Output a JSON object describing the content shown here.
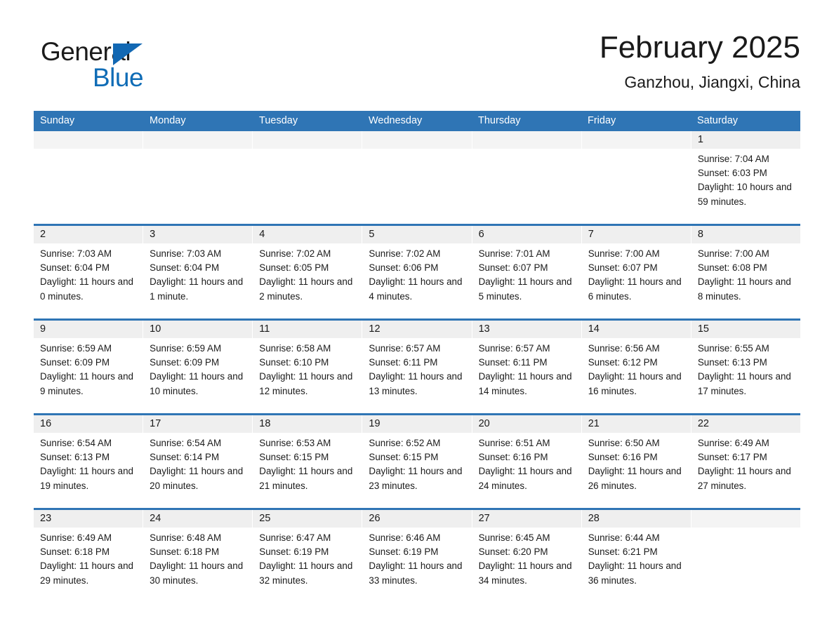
{
  "brand": {
    "name_part1": "General",
    "name_part2": "Blue",
    "accent_color": "#0f6cb6",
    "triangle_color": "#1268b3"
  },
  "header": {
    "title": "February 2025",
    "location": "Ganzhou, Jiangxi, China"
  },
  "theme": {
    "header_blue": "#2f75b5",
    "day_band_gray": "#efefef",
    "text_color": "#1a1a1a"
  },
  "weekdays": [
    "Sunday",
    "Monday",
    "Tuesday",
    "Wednesday",
    "Thursday",
    "Friday",
    "Saturday"
  ],
  "weeks": [
    [
      {
        "day": "",
        "sunrise": "",
        "sunset": "",
        "daylight": ""
      },
      {
        "day": "",
        "sunrise": "",
        "sunset": "",
        "daylight": ""
      },
      {
        "day": "",
        "sunrise": "",
        "sunset": "",
        "daylight": ""
      },
      {
        "day": "",
        "sunrise": "",
        "sunset": "",
        "daylight": ""
      },
      {
        "day": "",
        "sunrise": "",
        "sunset": "",
        "daylight": ""
      },
      {
        "day": "",
        "sunrise": "",
        "sunset": "",
        "daylight": ""
      },
      {
        "day": "1",
        "sunrise": "Sunrise: 7:04 AM",
        "sunset": "Sunset: 6:03 PM",
        "daylight": "Daylight: 10 hours and 59 minutes."
      }
    ],
    [
      {
        "day": "2",
        "sunrise": "Sunrise: 7:03 AM",
        "sunset": "Sunset: 6:04 PM",
        "daylight": "Daylight: 11 hours and 0 minutes."
      },
      {
        "day": "3",
        "sunrise": "Sunrise: 7:03 AM",
        "sunset": "Sunset: 6:04 PM",
        "daylight": "Daylight: 11 hours and 1 minute."
      },
      {
        "day": "4",
        "sunrise": "Sunrise: 7:02 AM",
        "sunset": "Sunset: 6:05 PM",
        "daylight": "Daylight: 11 hours and 2 minutes."
      },
      {
        "day": "5",
        "sunrise": "Sunrise: 7:02 AM",
        "sunset": "Sunset: 6:06 PM",
        "daylight": "Daylight: 11 hours and 4 minutes."
      },
      {
        "day": "6",
        "sunrise": "Sunrise: 7:01 AM",
        "sunset": "Sunset: 6:07 PM",
        "daylight": "Daylight: 11 hours and 5 minutes."
      },
      {
        "day": "7",
        "sunrise": "Sunrise: 7:00 AM",
        "sunset": "Sunset: 6:07 PM",
        "daylight": "Daylight: 11 hours and 6 minutes."
      },
      {
        "day": "8",
        "sunrise": "Sunrise: 7:00 AM",
        "sunset": "Sunset: 6:08 PM",
        "daylight": "Daylight: 11 hours and 8 minutes."
      }
    ],
    [
      {
        "day": "9",
        "sunrise": "Sunrise: 6:59 AM",
        "sunset": "Sunset: 6:09 PM",
        "daylight": "Daylight: 11 hours and 9 minutes."
      },
      {
        "day": "10",
        "sunrise": "Sunrise: 6:59 AM",
        "sunset": "Sunset: 6:09 PM",
        "daylight": "Daylight: 11 hours and 10 minutes."
      },
      {
        "day": "11",
        "sunrise": "Sunrise: 6:58 AM",
        "sunset": "Sunset: 6:10 PM",
        "daylight": "Daylight: 11 hours and 12 minutes."
      },
      {
        "day": "12",
        "sunrise": "Sunrise: 6:57 AM",
        "sunset": "Sunset: 6:11 PM",
        "daylight": "Daylight: 11 hours and 13 minutes."
      },
      {
        "day": "13",
        "sunrise": "Sunrise: 6:57 AM",
        "sunset": "Sunset: 6:11 PM",
        "daylight": "Daylight: 11 hours and 14 minutes."
      },
      {
        "day": "14",
        "sunrise": "Sunrise: 6:56 AM",
        "sunset": "Sunset: 6:12 PM",
        "daylight": "Daylight: 11 hours and 16 minutes."
      },
      {
        "day": "15",
        "sunrise": "Sunrise: 6:55 AM",
        "sunset": "Sunset: 6:13 PM",
        "daylight": "Daylight: 11 hours and 17 minutes."
      }
    ],
    [
      {
        "day": "16",
        "sunrise": "Sunrise: 6:54 AM",
        "sunset": "Sunset: 6:13 PM",
        "daylight": "Daylight: 11 hours and 19 minutes."
      },
      {
        "day": "17",
        "sunrise": "Sunrise: 6:54 AM",
        "sunset": "Sunset: 6:14 PM",
        "daylight": "Daylight: 11 hours and 20 minutes."
      },
      {
        "day": "18",
        "sunrise": "Sunrise: 6:53 AM",
        "sunset": "Sunset: 6:15 PM",
        "daylight": "Daylight: 11 hours and 21 minutes."
      },
      {
        "day": "19",
        "sunrise": "Sunrise: 6:52 AM",
        "sunset": "Sunset: 6:15 PM",
        "daylight": "Daylight: 11 hours and 23 minutes."
      },
      {
        "day": "20",
        "sunrise": "Sunrise: 6:51 AM",
        "sunset": "Sunset: 6:16 PM",
        "daylight": "Daylight: 11 hours and 24 minutes."
      },
      {
        "day": "21",
        "sunrise": "Sunrise: 6:50 AM",
        "sunset": "Sunset: 6:16 PM",
        "daylight": "Daylight: 11 hours and 26 minutes."
      },
      {
        "day": "22",
        "sunrise": "Sunrise: 6:49 AM",
        "sunset": "Sunset: 6:17 PM",
        "daylight": "Daylight: 11 hours and 27 minutes."
      }
    ],
    [
      {
        "day": "23",
        "sunrise": "Sunrise: 6:49 AM",
        "sunset": "Sunset: 6:18 PM",
        "daylight": "Daylight: 11 hours and 29 minutes."
      },
      {
        "day": "24",
        "sunrise": "Sunrise: 6:48 AM",
        "sunset": "Sunset: 6:18 PM",
        "daylight": "Daylight: 11 hours and 30 minutes."
      },
      {
        "day": "25",
        "sunrise": "Sunrise: 6:47 AM",
        "sunset": "Sunset: 6:19 PM",
        "daylight": "Daylight: 11 hours and 32 minutes."
      },
      {
        "day": "26",
        "sunrise": "Sunrise: 6:46 AM",
        "sunset": "Sunset: 6:19 PM",
        "daylight": "Daylight: 11 hours and 33 minutes."
      },
      {
        "day": "27",
        "sunrise": "Sunrise: 6:45 AM",
        "sunset": "Sunset: 6:20 PM",
        "daylight": "Daylight: 11 hours and 34 minutes."
      },
      {
        "day": "28",
        "sunrise": "Sunrise: 6:44 AM",
        "sunset": "Sunset: 6:21 PM",
        "daylight": "Daylight: 11 hours and 36 minutes."
      },
      {
        "day": "",
        "sunrise": "",
        "sunset": "",
        "daylight": ""
      }
    ]
  ]
}
